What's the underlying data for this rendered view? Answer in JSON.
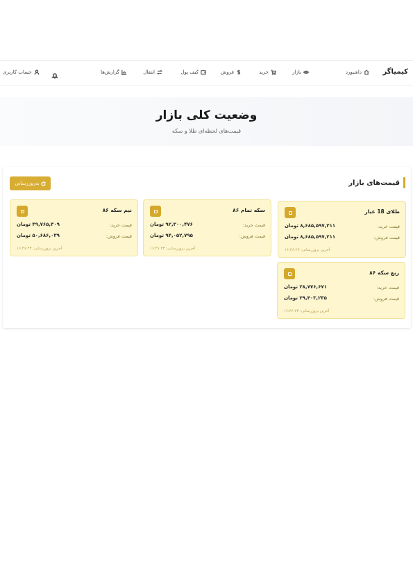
{
  "nav": {
    "brand": "کیمیاگر",
    "items": [
      {
        "label": "داشبورد",
        "icon": "home-icon"
      },
      {
        "label": "بازار",
        "icon": "eye-icon"
      },
      {
        "label": "خرید",
        "icon": "cart-icon"
      },
      {
        "label": "فروش",
        "icon": "dollar-icon"
      },
      {
        "label": "کیف پول",
        "icon": "wallet-icon"
      },
      {
        "label": "انتقال",
        "icon": "transfer-icon"
      },
      {
        "label": "گزارش‌ها",
        "icon": "chart-icon"
      }
    ],
    "account": "حساب کاربری",
    "bell_icon": "bell-icon"
  },
  "hero": {
    "title": "وضعیت کلی بازار",
    "subtitle": "قیمت‌های لحظه‌ای طلا و سکه"
  },
  "prices": {
    "section_title": "قیمت‌های  بازار",
    "refresh_label": "به‌روزرسانی",
    "buy_label": "قیمت خرید:",
    "sell_label": "قیمت فروش:",
    "updated_label": "آخرین بروزرسانی: ۱۶:۴۶:۲۳",
    "cards": [
      {
        "title": "طلای 18 عیار",
        "buy": "۸,۶۸۵,۵۹۷,۲۱۱ تومان",
        "sell": "۸,۶۸۵,۵۹۷,۲۱۱ تومان"
      },
      {
        "title": "سکه تمام ۸۶",
        "buy": "۹۲,۳۰۰,۴۷۶ تومان",
        "sell": "۹۴,۰۵۲,۷۹۵ تومان"
      },
      {
        "title": "نیم سکه ۸۶",
        "buy": "۴۹,۷۶۵,۳۰۹ تومان",
        "sell": "۵۰,۶۸۶,۰۳۹ تومان"
      },
      {
        "title": "ربع سکه ۸۶",
        "buy": "۲۸,۷۷۶,۶۷۱ تومان",
        "sell": "۲۹,۴۰۳,۲۳۵ تومان"
      }
    ]
  },
  "colors": {
    "accent": "#d4a82a",
    "card_bg": "#fdf6cf"
  }
}
